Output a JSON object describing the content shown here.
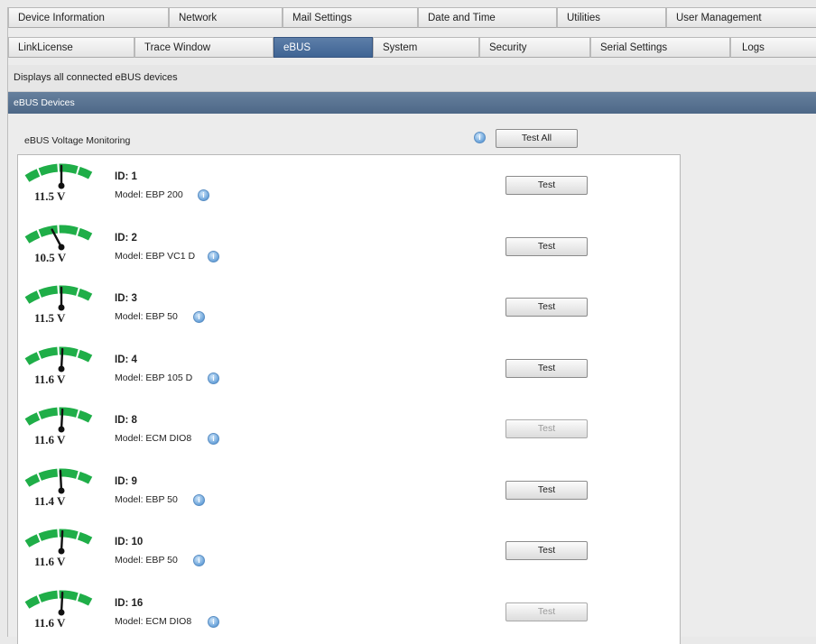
{
  "tabs_row1": [
    {
      "label": "Device Information",
      "active": false
    },
    {
      "label": "Network",
      "active": false
    },
    {
      "label": "Mail Settings",
      "active": false
    },
    {
      "label": "Date and Time",
      "active": false
    },
    {
      "label": "Utilities",
      "active": false
    },
    {
      "label": "User Management",
      "active": false
    }
  ],
  "tabs_row2": [
    {
      "label": "LinkLicense",
      "active": false
    },
    {
      "label": "Trace Window",
      "active": false
    },
    {
      "label": "eBUS",
      "active": true
    },
    {
      "label": "System",
      "active": false
    },
    {
      "label": "Security",
      "active": false
    },
    {
      "label": "Serial Settings",
      "active": false
    },
    {
      "label": "Logs",
      "active": false
    }
  ],
  "page": {
    "description": "Displays all connected eBUS devices",
    "section_title": "eBUS Devices",
    "monitoring_label": "eBUS Voltage Monitoring",
    "info_icon": "info-icon",
    "test_all_label": "Test All"
  },
  "colors": {
    "gauge_green": "#1fae48",
    "active_tab": "#4a6d9c",
    "section_bar": "#5a7592"
  },
  "devices": [
    {
      "id_text": "ID: 1",
      "model_text": "Model: EBP 200",
      "voltage": "11.5 V",
      "needle_deg": 0,
      "test_label": "Test",
      "enabled": true
    },
    {
      "id_text": "ID: 2",
      "model_text": "Model: EBP VC1 D",
      "voltage": "10.5 V",
      "needle_deg": -28,
      "test_label": "Test",
      "enabled": true
    },
    {
      "id_text": "ID: 3",
      "model_text": "Model: EBP 50",
      "voltage": "11.5 V",
      "needle_deg": 0,
      "test_label": "Test",
      "enabled": true
    },
    {
      "id_text": "ID: 4",
      "model_text": "Model: EBP 105 D",
      "voltage": "11.6 V",
      "needle_deg": 3,
      "test_label": "Test",
      "enabled": true
    },
    {
      "id_text": "ID: 8",
      "model_text": "Model: ECM DIO8",
      "voltage": "11.6 V",
      "needle_deg": 3,
      "test_label": "Test",
      "enabled": false
    },
    {
      "id_text": "ID: 9",
      "model_text": "Model: EBP 50",
      "voltage": "11.4 V",
      "needle_deg": -3,
      "test_label": "Test",
      "enabled": true
    },
    {
      "id_text": "ID: 10",
      "model_text": "Model: EBP 50",
      "voltage": "11.6 V",
      "needle_deg": 3,
      "test_label": "Test",
      "enabled": true
    },
    {
      "id_text": "ID: 16",
      "model_text": "Model: ECM DIO8",
      "voltage": "11.6 V",
      "needle_deg": 3,
      "test_label": "Test",
      "enabled": false
    }
  ]
}
